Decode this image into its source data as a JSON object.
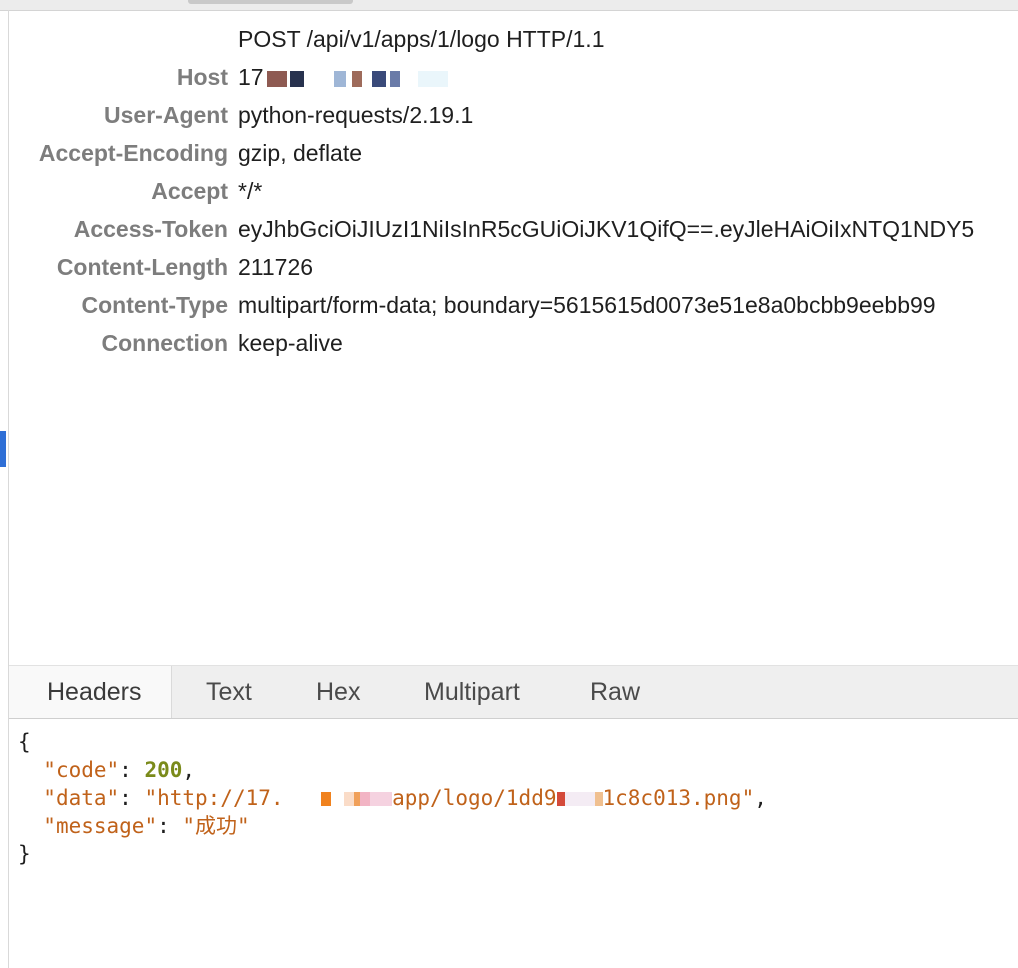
{
  "request": {
    "request_line": "POST /api/v1/apps/1/logo HTTP/1.1",
    "headers": [
      {
        "key": "Host",
        "value": "17"
      },
      {
        "key": "User-Agent",
        "value": "python-requests/2.19.1"
      },
      {
        "key": "Accept-Encoding",
        "value": "gzip, deflate"
      },
      {
        "key": "Accept",
        "value": "*/*"
      },
      {
        "key": "Access-Token",
        "value": "eyJhbGciOiJIUzI1NiIsInR5cGUiOiJKV1QifQ==.eyJleHAiOiIxNTQ1NDY5"
      },
      {
        "key": "Content-Length",
        "value": "211726"
      },
      {
        "key": "Content-Type",
        "value": "multipart/form-data; boundary=5615615d0073e51e8a0bcbb9eebb99"
      },
      {
        "key": "Connection",
        "value": "keep-alive"
      }
    ]
  },
  "tabs": [
    {
      "label": "Headers",
      "active": true
    },
    {
      "label": "Text",
      "active": false
    },
    {
      "label": "Hex",
      "active": false
    },
    {
      "label": "Multipart",
      "active": false
    },
    {
      "label": "Raw",
      "active": false
    }
  ],
  "response": {
    "open_brace": "{",
    "close_brace": "}",
    "code_key": "\"code\"",
    "code_value": "200",
    "data_key": "\"data\"",
    "data_value_start": "\"http://17.",
    "data_value_mid": "app/logo/1dd9",
    "data_value_end": "1c8c013.png\"",
    "message_key": "\"message\"",
    "message_value": "\"成功\""
  },
  "colors": {
    "json_string": "#c0621a",
    "json_number": "#7a8a1a",
    "header_key": "#7d7d7d",
    "selection_marker": "#2f6fd6"
  }
}
